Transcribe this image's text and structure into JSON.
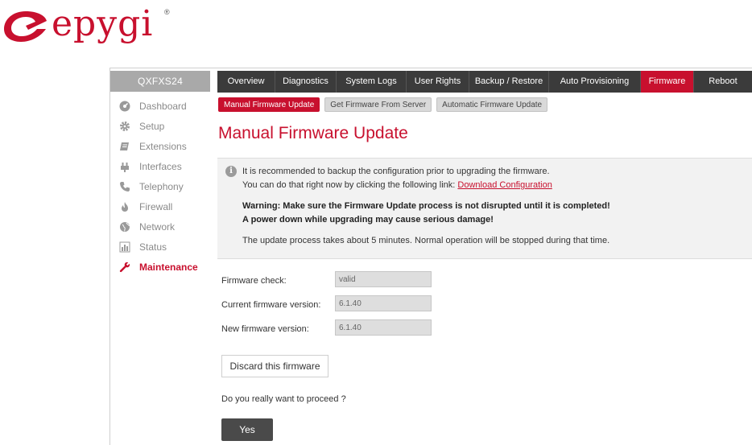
{
  "brand": {
    "name": "epygi",
    "registered_mark": "®",
    "color": "#c8102e"
  },
  "sidebar": {
    "device_name": "QXFXS24",
    "items": [
      {
        "label": "Dashboard",
        "icon": "dashboard-icon"
      },
      {
        "label": "Setup",
        "icon": "gear-icon"
      },
      {
        "label": "Extensions",
        "icon": "book-icon"
      },
      {
        "label": "Interfaces",
        "icon": "plug-icon"
      },
      {
        "label": "Telephony",
        "icon": "phone-icon"
      },
      {
        "label": "Firewall",
        "icon": "fire-icon"
      },
      {
        "label": "Network",
        "icon": "globe-icon"
      },
      {
        "label": "Status",
        "icon": "bar-chart-icon"
      },
      {
        "label": "Maintenance",
        "icon": "wrench-icon",
        "active": true
      }
    ]
  },
  "topnav": {
    "tabs": [
      {
        "label": "Overview"
      },
      {
        "label": "Diagnostics"
      },
      {
        "label": "System Logs"
      },
      {
        "label": "User Rights"
      },
      {
        "label": "Backup / Restore"
      },
      {
        "label": "Auto Provisioning"
      },
      {
        "label": "Firmware",
        "active": true
      },
      {
        "label": "Reboot"
      }
    ]
  },
  "subtabs": [
    {
      "label": "Manual Firmware Update",
      "active": true
    },
    {
      "label": "Get Firmware From Server"
    },
    {
      "label": "Automatic Firmware Update"
    }
  ],
  "page_title": "Manual Firmware Update",
  "info": {
    "line1": "It is recommended to backup the configuration prior to upgrading the firmware.",
    "line2_prefix": "You can do that right now by clicking the following link: ",
    "link_label": "Download Configuration",
    "warning1": "Warning: Make sure the Firmware Update process is not disrupted until it is completed!",
    "warning2": "A power down while upgrading may cause serious damage!",
    "note": "The update process takes about 5 minutes. Normal operation will be stopped during that time."
  },
  "form": {
    "firmware_check_label": "Firmware check:",
    "firmware_check_value": "valid",
    "current_version_label": "Current firmware version:",
    "current_version_value": "6.1.40",
    "new_version_label": "New firmware version:",
    "new_version_value": "6.1.40"
  },
  "actions": {
    "discard_label": "Discard this firmware",
    "question": "Do you really want to proceed ?",
    "yes_label": "Yes"
  },
  "colors": {
    "accent": "#c8102e",
    "nav_bg": "#3b3b3b",
    "sidebar_header_bg": "#a9a9a9",
    "info_bg": "#f2f2f2"
  }
}
